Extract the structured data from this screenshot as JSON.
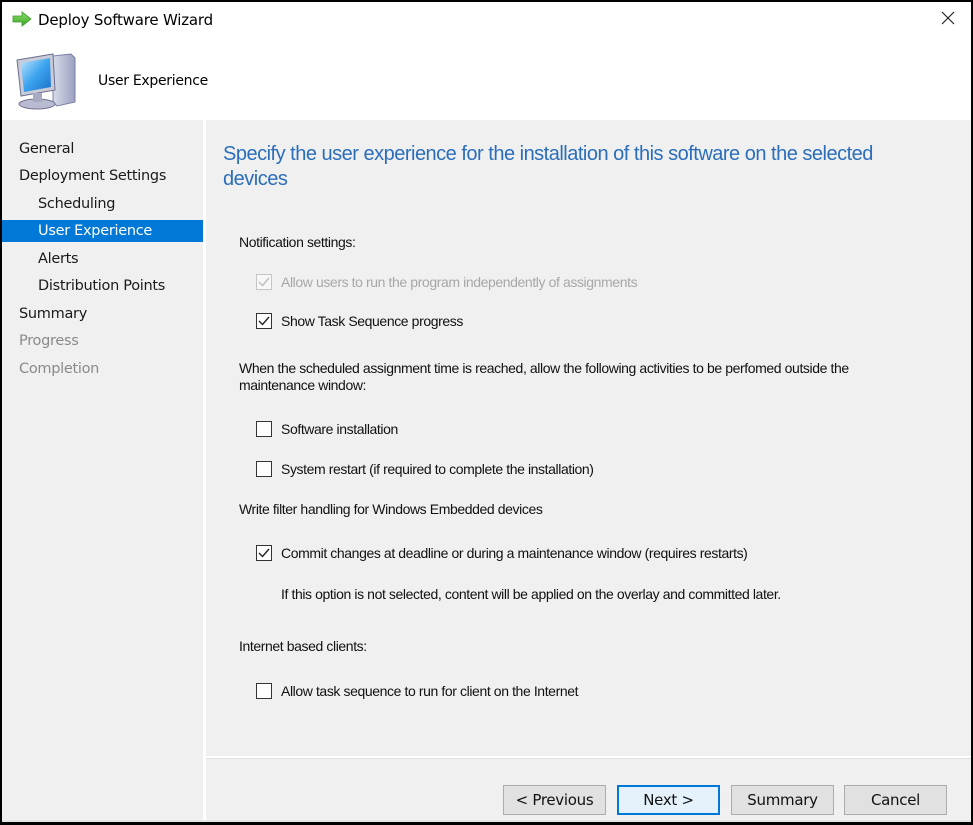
{
  "window": {
    "title": "Deploy Software Wizard",
    "title_icon": "green-arrow-icon",
    "close_icon": "close-icon"
  },
  "header": {
    "icon": "computer-icon",
    "page_title": "User Experience"
  },
  "sidebar": {
    "items": [
      {
        "label": "General",
        "level": 1,
        "state": "normal"
      },
      {
        "label": "Deployment Settings",
        "level": 1,
        "state": "normal"
      },
      {
        "label": "Scheduling",
        "level": 2,
        "state": "normal"
      },
      {
        "label": "User Experience",
        "level": 2,
        "state": "selected"
      },
      {
        "label": "Alerts",
        "level": 2,
        "state": "normal"
      },
      {
        "label": "Distribution Points",
        "level": 2,
        "state": "normal"
      },
      {
        "label": "Summary",
        "level": 1,
        "state": "normal"
      },
      {
        "label": "Progress",
        "level": 1,
        "state": "disabled"
      },
      {
        "label": "Completion",
        "level": 1,
        "state": "disabled"
      }
    ]
  },
  "main": {
    "heading_line1": "Specify the user experience for the installation of this software on the selected",
    "heading_line2": "devices",
    "notification": {
      "label": "Notification settings:",
      "allow_users": {
        "label": "Allow users to run the program independently of assignments",
        "checked": true,
        "disabled": true
      },
      "show_progress": {
        "label": "Show Task Sequence progress",
        "checked": true,
        "disabled": false
      }
    },
    "maintenance": {
      "label_line1": "When the scheduled assignment time is reached, allow the following activities to be perfomed outside the",
      "label_line2": "maintenance window:",
      "software_install": {
        "label": "Software installation",
        "checked": false
      },
      "system_restart": {
        "label": "System restart (if required to complete the installation)",
        "checked": false
      }
    },
    "write_filter": {
      "label": "Write filter handling for Windows Embedded devices",
      "commit_changes": {
        "label": "Commit changes at deadline or during a maintenance window (requires restarts)",
        "checked": true
      },
      "note": "If this option is not selected, content will be applied on the overlay and committed later."
    },
    "internet": {
      "label": "Internet based clients:",
      "allow_internet": {
        "label": "Allow task sequence to run for client on the Internet",
        "checked": false
      }
    }
  },
  "buttons": {
    "previous": "< Previous",
    "next": "Next >",
    "summary": "Summary",
    "cancel": "Cancel"
  },
  "colors": {
    "accent": "#0078d7",
    "heading": "#2a6ebb",
    "panel_bg": "#f0f0f0"
  }
}
